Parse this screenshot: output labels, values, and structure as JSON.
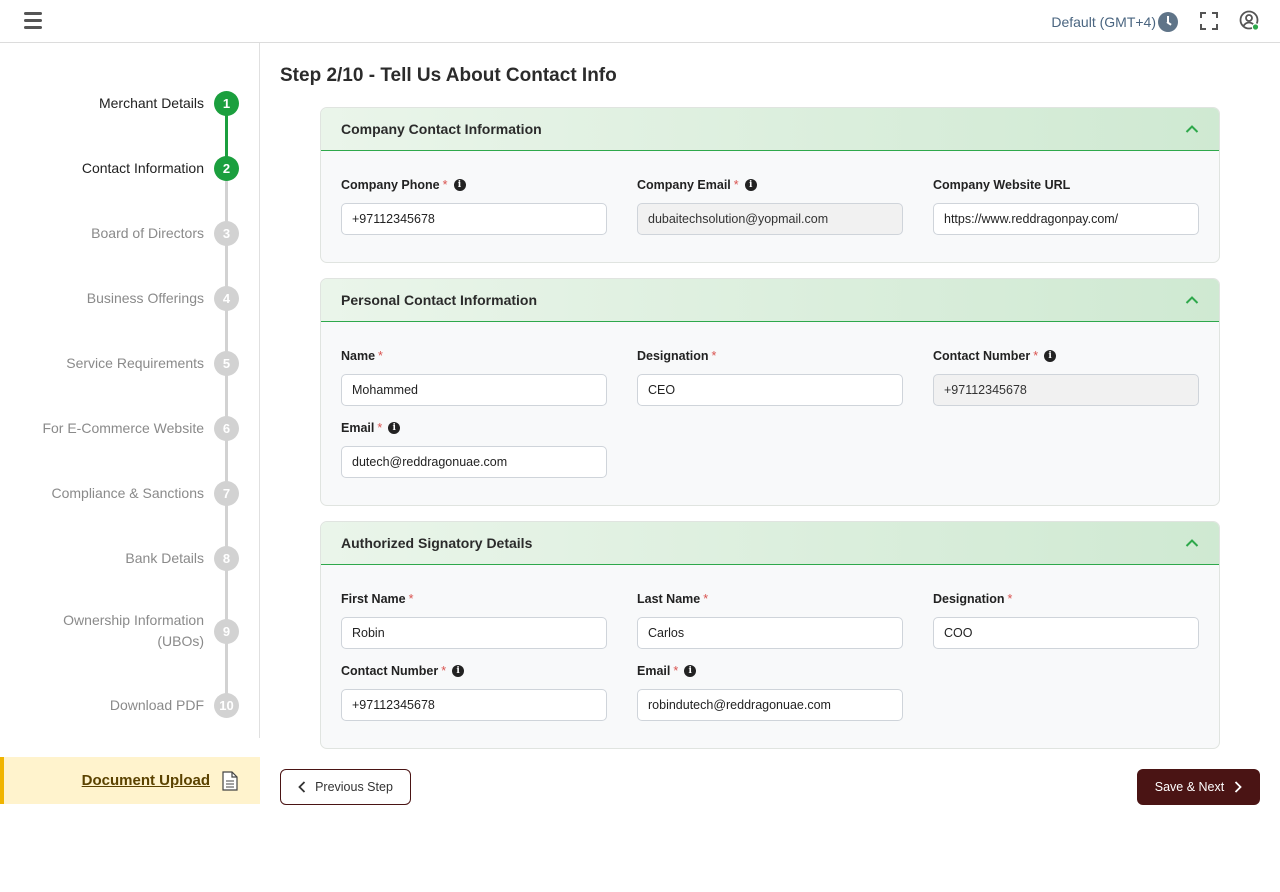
{
  "header": {
    "timezone": "Default (GMT+4)"
  },
  "stepper": {
    "steps": [
      {
        "num": "1",
        "label": "Merchant Details",
        "state": "done"
      },
      {
        "num": "2",
        "label": "Contact Information",
        "state": "active"
      },
      {
        "num": "3",
        "label": "Board of Directors",
        "state": "todo"
      },
      {
        "num": "4",
        "label": "Business Offerings",
        "state": "todo"
      },
      {
        "num": "5",
        "label": "Service Requirements",
        "state": "todo"
      },
      {
        "num": "6",
        "label": "For E-Commerce Website",
        "state": "todo"
      },
      {
        "num": "7",
        "label": "Compliance & Sanctions",
        "state": "todo"
      },
      {
        "num": "8",
        "label": "Bank Details",
        "state": "todo"
      },
      {
        "num": "9",
        "label": "Ownership Information (UBOs)",
        "label_line1": "Ownership Information",
        "label_line2": "(UBOs)",
        "state": "todo"
      },
      {
        "num": "10",
        "label": "Download PDF",
        "state": "todo"
      }
    ],
    "document_upload": "Document Upload",
    "colors": {
      "active": "#1b9f3e",
      "inactive": "#d2d2d2"
    }
  },
  "main": {
    "title": "Step 2/10 - Tell Us About Contact Info",
    "company_card": {
      "title": "Company Contact Information",
      "phone": {
        "label": "Company Phone",
        "value": "+97112345678"
      },
      "email": {
        "label": "Company Email",
        "value": "dubaitechsolution@yopmail.com"
      },
      "website": {
        "label": "Company Website URL",
        "value": "https://www.reddragonpay.com/"
      }
    },
    "personal_card": {
      "title": "Personal Contact Information",
      "name": {
        "label": "Name",
        "value": "Mohammed"
      },
      "designation": {
        "label": "Designation",
        "value": "CEO"
      },
      "contact_number": {
        "label": "Contact Number",
        "value": "+97112345678"
      },
      "email": {
        "label": "Email",
        "value": "dutech@reddragonuae.com"
      }
    },
    "signatory_card": {
      "title": "Authorized Signatory Details",
      "first_name": {
        "label": "First Name",
        "value": "Robin"
      },
      "last_name": {
        "label": "Last Name",
        "value": "Carlos"
      },
      "designation": {
        "label": "Designation",
        "value": "COO"
      },
      "contact_number": {
        "label": "Contact Number",
        "value": "+97112345678"
      },
      "email": {
        "label": "Email",
        "value": "robindutech@reddragonuae.com"
      }
    },
    "required_mark": "*",
    "info_glyph": "i"
  },
  "footer": {
    "prev_label": "Previous Step",
    "next_label": "Save & Next",
    "brand_color": "#4a1414"
  }
}
